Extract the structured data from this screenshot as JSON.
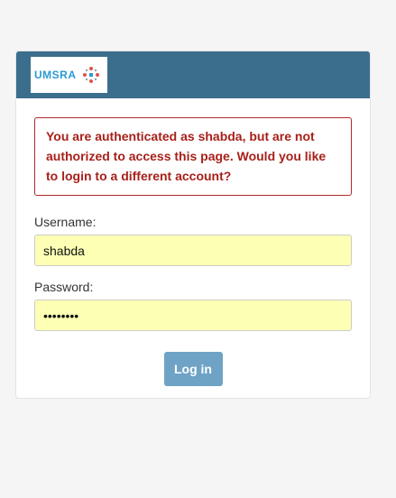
{
  "header": {
    "logo_text": "UMSRA"
  },
  "alert": {
    "message": "You are authenticated as shabda, but are not authorized to access this page. Would you like to login to a different account?"
  },
  "form": {
    "username_label": "Username:",
    "username_value": "shabda",
    "password_label": "Password:",
    "password_value": "password",
    "login_label": "Log in"
  },
  "colors": {
    "header_bg": "#3b6e8d",
    "alert_text": "#a8201a",
    "input_autofill_bg": "#fcffb4",
    "button_bg": "#6fa3c6"
  }
}
